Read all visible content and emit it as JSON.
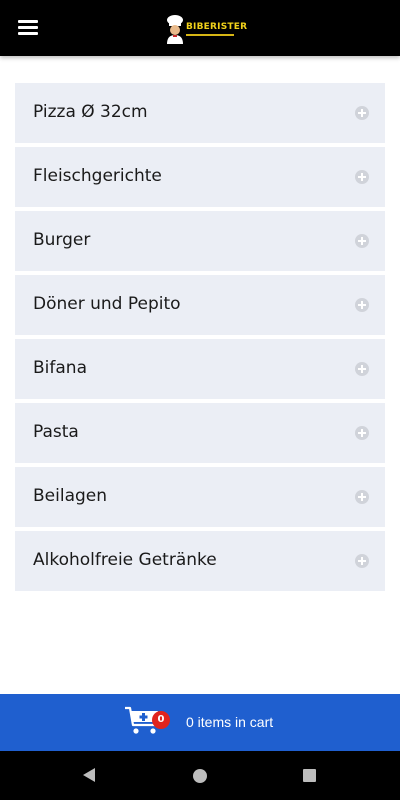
{
  "header": {
    "logo_text": "BIBERISTER",
    "menu_icon": "hamburger-icon"
  },
  "menu": {
    "items": [
      {
        "label": "Pizza Ø 32cm",
        "icon": "plus-circle-icon"
      },
      {
        "label": "Fleischgerichte",
        "icon": "plus-circle-icon"
      },
      {
        "label": "Burger",
        "icon": "plus-circle-icon"
      },
      {
        "label": "Döner und Pepito",
        "icon": "plus-circle-icon"
      },
      {
        "label": "Bifana",
        "icon": "plus-circle-icon"
      },
      {
        "label": "Pasta",
        "icon": "plus-circle-icon"
      },
      {
        "label": "Beilagen",
        "icon": "plus-circle-icon"
      },
      {
        "label": "Alkoholfreie Getränke",
        "icon": "plus-circle-icon"
      }
    ]
  },
  "cart": {
    "count": "0",
    "text": "0 items in cart",
    "icon": "cart-plus-icon"
  },
  "colors": {
    "topbar": "#000000",
    "item_bg": "#ebeef5",
    "cart_bar": "#1f5fcf",
    "badge": "#e0241e",
    "logo_yellow": "#f2d21a"
  },
  "system_nav": {
    "back_icon": "back-icon",
    "home_icon": "home-icon",
    "recents_icon": "recents-icon"
  }
}
